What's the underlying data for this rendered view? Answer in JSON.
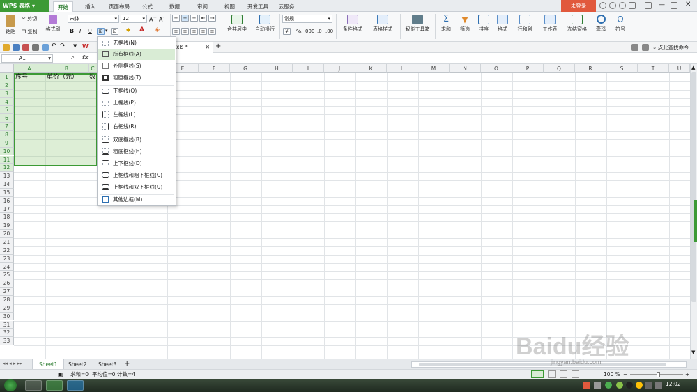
{
  "app": {
    "name": "WPS 表格",
    "login": "未登录"
  },
  "menu": [
    "开始",
    "插入",
    "页面布局",
    "公式",
    "数据",
    "审阅",
    "视图",
    "开发工具",
    "云服务"
  ],
  "ribbon": {
    "paste": "粘贴",
    "cut": "剪切",
    "copy": "复制",
    "format_painter": "格式刷",
    "font_name": "宋体",
    "font_size": "12",
    "merge_center": "合并居中",
    "wrap_text": "自动换行",
    "number_format": "常规",
    "percent": "%",
    "conditional_format": "条件格式",
    "table_style": "表格样式",
    "smart_toolbox": "智能工具箱",
    "sum": "求和",
    "filter": "筛选",
    "sort": "排序",
    "format": "格式",
    "row_col": "行和列",
    "worksheet": "工作表",
    "freeze": "冻结窗格",
    "find": "查找",
    "symbol": "符号"
  },
  "toolbar": {
    "doc_tab": "xls *",
    "find_command": "点此查找命令"
  },
  "formula_bar": {
    "name_box": "A1",
    "fx": "fx"
  },
  "columns": [
    "A",
    "B",
    "C",
    "D",
    "E",
    "F",
    "G",
    "H",
    "I",
    "J",
    "K",
    "L",
    "M",
    "N",
    "O",
    "P",
    "Q",
    "R",
    "S",
    "T",
    "U"
  ],
  "rows": [
    "1",
    "2",
    "3",
    "4",
    "5",
    "6",
    "7",
    "8",
    "9",
    "10",
    "11",
    "12",
    "13",
    "14",
    "15",
    "16",
    "17",
    "18",
    "19",
    "20",
    "21",
    "22",
    "23",
    "24",
    "25",
    "26",
    "27",
    "28",
    "29",
    "30",
    "31",
    "32",
    "33"
  ],
  "cells": {
    "a1": "序号",
    "b1": "单价（元）",
    "c1": "数"
  },
  "border_menu": [
    {
      "label": "无框线(N)"
    },
    {
      "label": "所有框线(A)"
    },
    {
      "label": "外侧框线(S)"
    },
    {
      "label": "粗匣框线(T)"
    },
    {
      "label": "下框线(O)"
    },
    {
      "label": "上框线(P)"
    },
    {
      "label": "左框线(L)"
    },
    {
      "label": "右框线(R)"
    },
    {
      "label": "双底框线(B)"
    },
    {
      "label": "粗底框线(H)"
    },
    {
      "label": "上下框线(D)"
    },
    {
      "label": "上框线和粗下框线(C)"
    },
    {
      "label": "上框线和双下框线(U)"
    },
    {
      "label": "其他边框(M)..."
    }
  ],
  "sheets": [
    "Sheet1",
    "Sheet2",
    "Sheet3"
  ],
  "status": {
    "sum": "求和=0",
    "avg": "平均值=0",
    "count": "计数=4",
    "zoom": "100 %"
  },
  "taskbar": {
    "time": "12:02"
  },
  "watermark": {
    "main": "Baidu经验",
    "sub": "jingyan.baidu.com"
  },
  "colors": {
    "accent": "#3c9a35",
    "login": "#e1593d",
    "selection": "#d9ecd5"
  }
}
